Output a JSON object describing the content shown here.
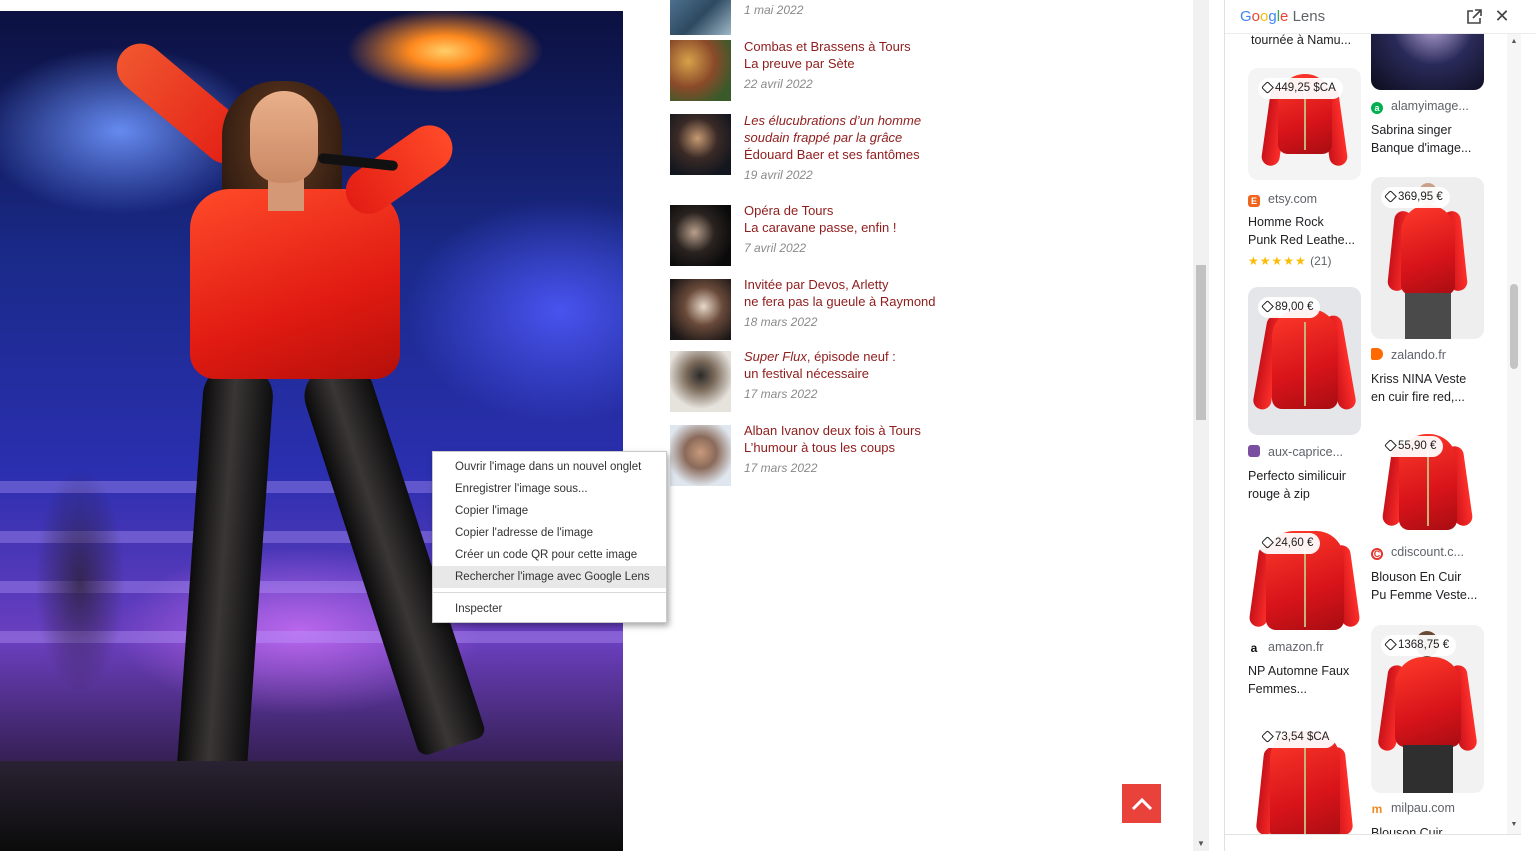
{
  "articles": [
    {
      "title_lines": [],
      "date": "1 mai 2022",
      "italic": false
    },
    {
      "title_lines": [
        "Combas et Brassens à Tours",
        "La preuve par Sète"
      ],
      "date": "22 avril 2022",
      "italic": false
    },
    {
      "title_lines": [
        "Les élucubrations d’un homme",
        "soudain frappé par la grâce",
        "Édouard Baer et ses fantômes"
      ],
      "date": "19 avril 2022",
      "italic_lines": 2
    },
    {
      "title_lines": [
        "Opéra de Tours",
        "La caravane passe, enfin !"
      ],
      "date": "7 avril 2022",
      "italic": false
    },
    {
      "title_lines": [
        "Invitée par Devos, Arletty",
        "ne fera pas la gueule à Raymond"
      ],
      "date": "18 mars 2022",
      "italic": false
    },
    {
      "title_lines": [
        "Super Flux, épisode neuf :",
        "un festival nécessaire"
      ],
      "date": "17 mars 2022",
      "italic_prefix": "Super Flux"
    },
    {
      "title_lines": [
        "Alban Ivanov deux fois à Tours",
        "L’humour à tous les coups"
      ],
      "date": "17 mars 2022",
      "italic": false
    }
  ],
  "context_menu": {
    "items": [
      "Ouvrir l'image dans un nouvel onglet",
      "Enregistrer l'image sous...",
      "Copier l'image",
      "Copier l'adresse de l'image",
      "Créer un code QR pour cette image",
      "Rechercher l'image avec Google Lens"
    ],
    "highlighted_index": 5,
    "inspect": "Inspecter"
  },
  "lens": {
    "logo": {
      "g": "G",
      "o1": "o",
      "o2": "o",
      "g2": "g",
      "l": "l",
      "e": "e",
      "lens": "Lens"
    },
    "top_left_title": "tournée à Namu...",
    "left_column": [
      {
        "price": "449,25 $CA",
        "source": "etsy.com",
        "favicon_color": "#f1641e",
        "favicon_letter": "E",
        "title": [
          "Homme Rock",
          "Punk Red Leathe..."
        ],
        "rating": "★★★★★",
        "reviews": "(21)"
      },
      {
        "price": "89,00 €",
        "source": "aux-caprice...",
        "favicon_color": "#7a4fa0",
        "favicon_letter": "",
        "title": [
          "Perfecto similicuir",
          "rouge à zip"
        ]
      },
      {
        "price": "24,60 €",
        "source": "amazon.fr",
        "favicon_color": "#ffffff",
        "favicon_letter": "a",
        "title": [
          "NP Automne Faux",
          "Femmes..."
        ]
      },
      {
        "price": "73,54 $CA",
        "source": "",
        "title": []
      }
    ],
    "right_column": [
      {
        "price": "",
        "source": "alamyimage...",
        "favicon_color": "#00b050",
        "favicon_letter": "a",
        "title": [
          "Sabrina singer",
          "Banque d'image..."
        ]
      },
      {
        "price": "369,95 €",
        "source": "zalando.fr",
        "favicon_color": "#ff6900",
        "favicon_letter": "",
        "title": [
          "Kriss NINA Veste",
          "en cuir fire red,..."
        ]
      },
      {
        "price": "55,90 €",
        "source": "cdiscount.c...",
        "favicon_color": "#ffffff",
        "favicon_letter": "C",
        "title": [
          "Blouson En Cuir",
          "Pu Femme Veste..."
        ]
      },
      {
        "price": "1368,75 €",
        "source": "milpau.com",
        "favicon_color": "#ffffff",
        "favicon_letter": "m",
        "title": [
          "Blouson Cuir"
        ]
      }
    ]
  },
  "colors": {
    "article_title": "#8f1c1c",
    "article_date": "#8a8a8a",
    "back_to_top": "#e8423b",
    "jacket_red": "#e11b12"
  },
  "icons": {
    "back_to_top": "chevron-up-icon",
    "lens_open": "open-in-new-tab-icon",
    "lens_close": "close-icon",
    "price_tag": "tag-icon"
  }
}
